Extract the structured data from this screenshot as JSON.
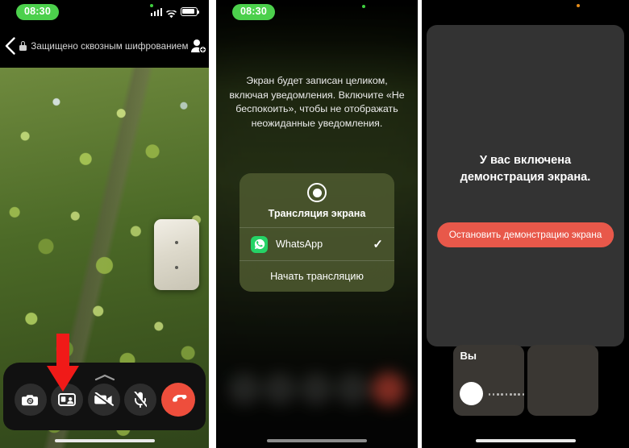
{
  "panels": {
    "left": {
      "status": {
        "time": "08:30",
        "signal_icon": "signal-bars-icon",
        "wifi_icon": "wifi-icon",
        "battery_icon": "battery-icon"
      },
      "header": {
        "back_icon": "back-chevron-icon",
        "lock_icon": "lock-icon",
        "encryption_text": "Защищено сквозным шифрованием",
        "add_participant_icon": "add-person-icon"
      },
      "controls": {
        "expand_icon": "chevron-up-icon",
        "buttons": [
          {
            "name": "switch-camera-button",
            "icon": "camera-flip-icon",
            "label": ""
          },
          {
            "name": "share-screen-button",
            "icon": "screen-share-icon",
            "label": ""
          },
          {
            "name": "toggle-video-button",
            "icon": "video-off-icon",
            "label": ""
          },
          {
            "name": "toggle-mic-button",
            "icon": "mic-off-icon",
            "label": ""
          },
          {
            "name": "end-call-button",
            "icon": "end-call-icon",
            "label": ""
          }
        ]
      },
      "annotation": {
        "arrow_color": "#F01A18",
        "points_to": "share-screen-button"
      },
      "self_view_label": ""
    },
    "middle": {
      "status": {
        "time": "08:30",
        "privacy_dot_color": "#3FCF3F"
      },
      "notice": "Экран будет записан целиком, включая уведомления. Включите «Не беспокоить», чтобы не отображать неожиданные уведомления.",
      "sheet": {
        "record_icon": "record-circle-icon",
        "title": "Трансляция экрана",
        "app": {
          "icon": "whatsapp-icon",
          "name": "WhatsApp",
          "selected_mark": "✓"
        },
        "start_label": "Начать трансляцию"
      }
    },
    "right": {
      "status": {
        "privacy_dot_color": "#E58C1A"
      },
      "share_message": "У вас включена\nдемонстрация экрана.",
      "share_message_line1": "У вас включена",
      "share_message_line2": "демонстрация экрана.",
      "stop_button": "Остановить демонстрацию экрана",
      "thumbnails": [
        {
          "name": "self-thumbnail",
          "label": "Вы",
          "has_avatar": true
        },
        {
          "name": "remote-thumbnail",
          "label": "",
          "has_avatar": false
        }
      ]
    }
  },
  "colors": {
    "accent_green": "#4CD04C",
    "whatsapp_green": "#25D366",
    "end_call_red": "#EE4E3C",
    "stop_button_red": "#E8584A",
    "annotation_red": "#F01A18",
    "card_gray": "#333333"
  }
}
